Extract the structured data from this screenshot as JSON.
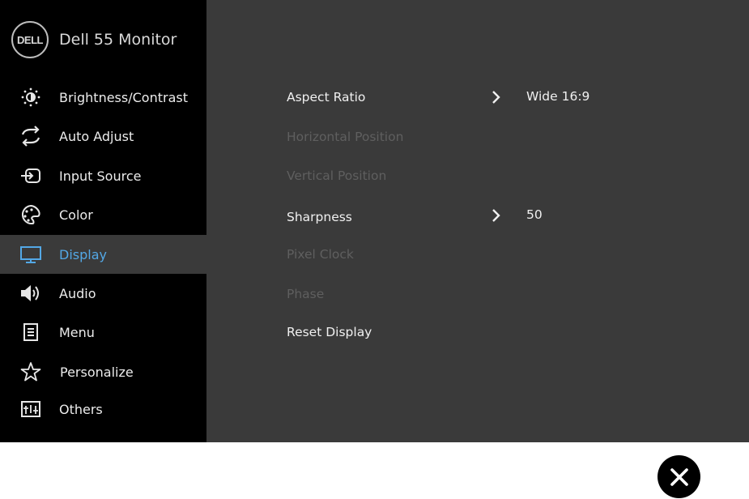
{
  "header": {
    "logo_text": "DELL",
    "model": "Dell 55 Monitor"
  },
  "sidebar": {
    "items": [
      {
        "label": "Brightness/Contrast",
        "icon": "brightness-icon"
      },
      {
        "label": "Auto Adjust",
        "icon": "auto-adjust-icon"
      },
      {
        "label": "Input Source",
        "icon": "input-source-icon"
      },
      {
        "label": "Color",
        "icon": "color-palette-icon"
      },
      {
        "label": "Display",
        "icon": "monitor-icon",
        "active": true
      },
      {
        "label": "Audio",
        "icon": "speaker-icon"
      },
      {
        "label": "Menu",
        "icon": "menu-icon"
      },
      {
        "label": "Personalize",
        "icon": "star-icon"
      },
      {
        "label": "Others",
        "icon": "others-icon"
      }
    ]
  },
  "main": {
    "rows": [
      {
        "label": "Aspect Ratio",
        "value": "Wide 16:9",
        "enabled": true
      },
      {
        "label": "Horizontal Position",
        "enabled": false
      },
      {
        "label": "Vertical Position",
        "enabled": false
      },
      {
        "label": "Sharpness",
        "value": "50",
        "enabled": true
      },
      {
        "label": "Pixel Clock",
        "enabled": false
      },
      {
        "label": "Phase",
        "enabled": false
      },
      {
        "label": "Reset Display",
        "enabled": true
      }
    ]
  },
  "colors": {
    "active_text": "#53a8e6",
    "sidebar_bg": "#000000",
    "panel_bg": "#3a3a3a",
    "disabled_text": "#5f5f5f"
  }
}
